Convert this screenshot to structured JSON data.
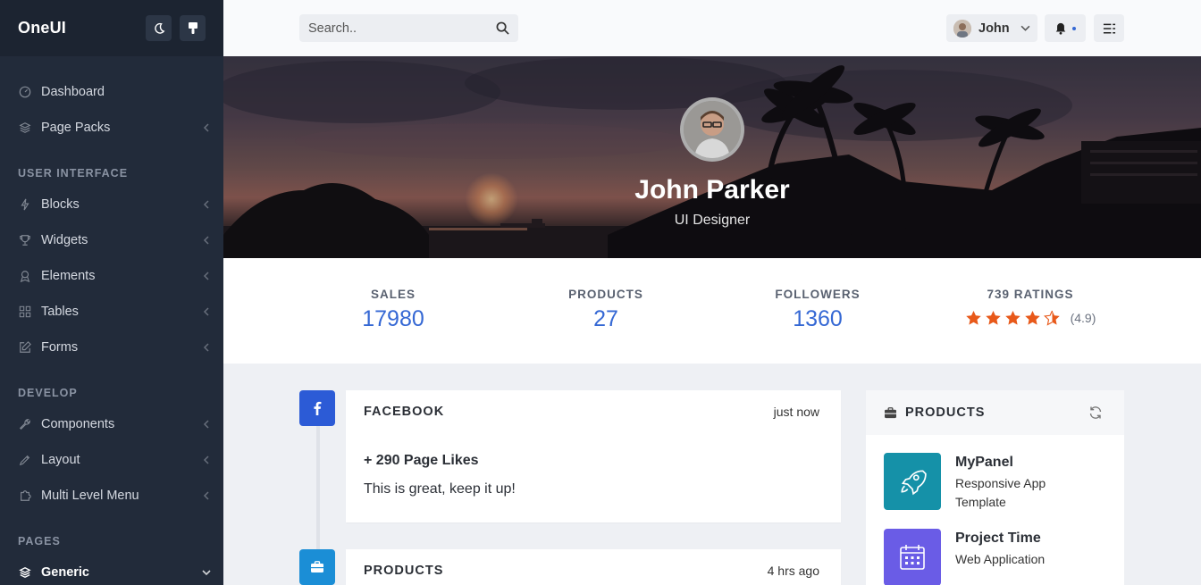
{
  "brand": "OneUI",
  "sidebar": {
    "top_items": [
      {
        "label": "Dashboard",
        "icon": "gauge-icon"
      },
      {
        "label": "Page Packs",
        "icon": "layers-icon"
      }
    ],
    "sections": [
      {
        "heading": "User Interface",
        "items": [
          {
            "label": "Blocks",
            "icon": "bolt-icon"
          },
          {
            "label": "Widgets",
            "icon": "trophy-icon"
          },
          {
            "label": "Elements",
            "icon": "badge-icon"
          },
          {
            "label": "Tables",
            "icon": "grid-icon"
          },
          {
            "label": "Forms",
            "icon": "pencil-square-icon"
          }
        ]
      },
      {
        "heading": "Develop",
        "items": [
          {
            "label": "Components",
            "icon": "wrench-icon"
          },
          {
            "label": "Layout",
            "icon": "pen-icon"
          },
          {
            "label": "Multi Level Menu",
            "icon": "puzzle-icon"
          }
        ]
      },
      {
        "heading": "Pages",
        "items": [
          {
            "label": "Generic",
            "icon": "layers-icon"
          }
        ]
      }
    ]
  },
  "header": {
    "search_placeholder": "Search..",
    "user_name": "John"
  },
  "profile": {
    "name": "John Parker",
    "role": "UI Designer"
  },
  "stats": [
    {
      "label": "Sales",
      "value": "17980"
    },
    {
      "label": "Products",
      "value": "27"
    },
    {
      "label": "Followers",
      "value": "1360"
    }
  ],
  "ratings": {
    "label": "739 Ratings",
    "value": 4.5,
    "score_text": "(4.9)",
    "star_color": "#e8591a"
  },
  "timeline": [
    {
      "title": "Facebook",
      "time": "just now",
      "line1": "+ 290 Page Likes",
      "line2": "This is great, keep it up!",
      "icon": "facebook-icon",
      "color": "#2c5bd6"
    },
    {
      "title": "Products",
      "time": "4 hrs ago",
      "icon": "briefcase-icon",
      "color": "#1b8ed6"
    }
  ],
  "products_panel": {
    "title": "Products",
    "items": [
      {
        "name": "MyPanel",
        "desc": "Responsive App Template",
        "icon": "rocket-icon",
        "color": "#1591a8"
      },
      {
        "name": "Project Time",
        "desc": "Web Application",
        "icon": "calendar-icon",
        "color": "#6a5ce6"
      }
    ]
  },
  "colors": {
    "sidebar_bg": "#222b3a",
    "accent": "#3568d4"
  }
}
